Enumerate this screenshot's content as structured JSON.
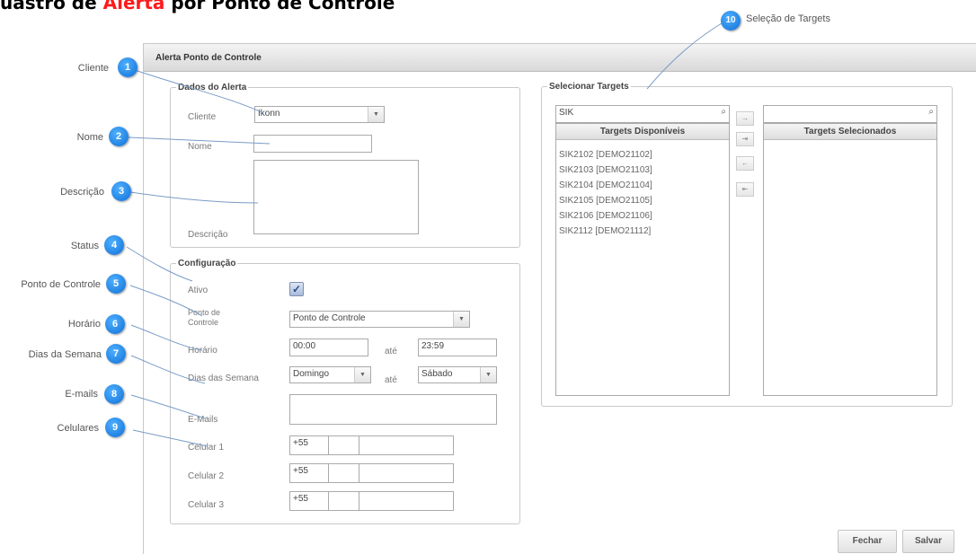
{
  "page_title": {
    "prefix": "uastro de ",
    "highlight": "Alerta",
    "suffix": " por Ponto de Controle"
  },
  "window": {
    "title": "Alerta Ponto de Controle"
  },
  "dados_alerta": {
    "legend": "Dados do Alerta",
    "cliente_label": "Cliente",
    "cliente_value": "Ikonn",
    "nome_label": "Nome",
    "nome_value": "",
    "descricao_label": "Descrição",
    "descricao_value": ""
  },
  "configuracao": {
    "legend": "Configuração",
    "ativo_label": "Ativo",
    "ativo_checked": true,
    "ponto_label": "Ponto de Controle",
    "ponto_value": "Ponto de Controle",
    "horario_label": "Horário",
    "horario_start": "00:00",
    "horario_end": "23:59",
    "ate_label": "até",
    "dias_label": "Dias das Semana",
    "dia_start": "Domingo",
    "dia_end": "Sábado",
    "emails_label": "E-Mails",
    "emails_value": "",
    "celulares": [
      {
        "label": "Celular 1",
        "ddi": "+55",
        "ddd": "",
        "number": ""
      },
      {
        "label": "Celular 2",
        "ddi": "+55",
        "ddd": "",
        "number": ""
      },
      {
        "label": "Celular 3",
        "ddi": "+55",
        "ddd": "",
        "number": ""
      }
    ]
  },
  "targets": {
    "legend": "Selecionar Targets",
    "search_available": "SIK",
    "search_selected": "",
    "available_header": "Targets Disponíveis",
    "selected_header": "Targets Selecionados",
    "available": [
      "SIK2102 [DEMO21102]",
      "SIK2103 [DEMO21103]",
      "SIK2104 [DEMO21104]",
      "SIK2105 [DEMO21105]",
      "SIK2106 [DEMO21106]",
      "SIK2112 [DEMO21112]"
    ],
    "selected": [],
    "move_buttons": [
      "→",
      "⇥",
      "←",
      "⇤"
    ]
  },
  "buttons": {
    "close": "Fechar",
    "save": "Salvar"
  },
  "callouts": [
    {
      "number": "1",
      "label": "Cliente"
    },
    {
      "number": "2",
      "label": "Nome"
    },
    {
      "number": "3",
      "label": "Descrição"
    },
    {
      "number": "4",
      "label": "Status"
    },
    {
      "number": "5",
      "label": "Ponto de Controle"
    },
    {
      "number": "6",
      "label": "Horário"
    },
    {
      "number": "7",
      "label": "Dias da Semana"
    },
    {
      "number": "8",
      "label": "E-mails"
    },
    {
      "number": "9",
      "label": "Celulares"
    },
    {
      "number": "10",
      "label": "Seleção de Targets"
    }
  ],
  "icons": {
    "search": "search-icon",
    "dropdown": "chevron-down-icon",
    "check": "check-icon"
  }
}
